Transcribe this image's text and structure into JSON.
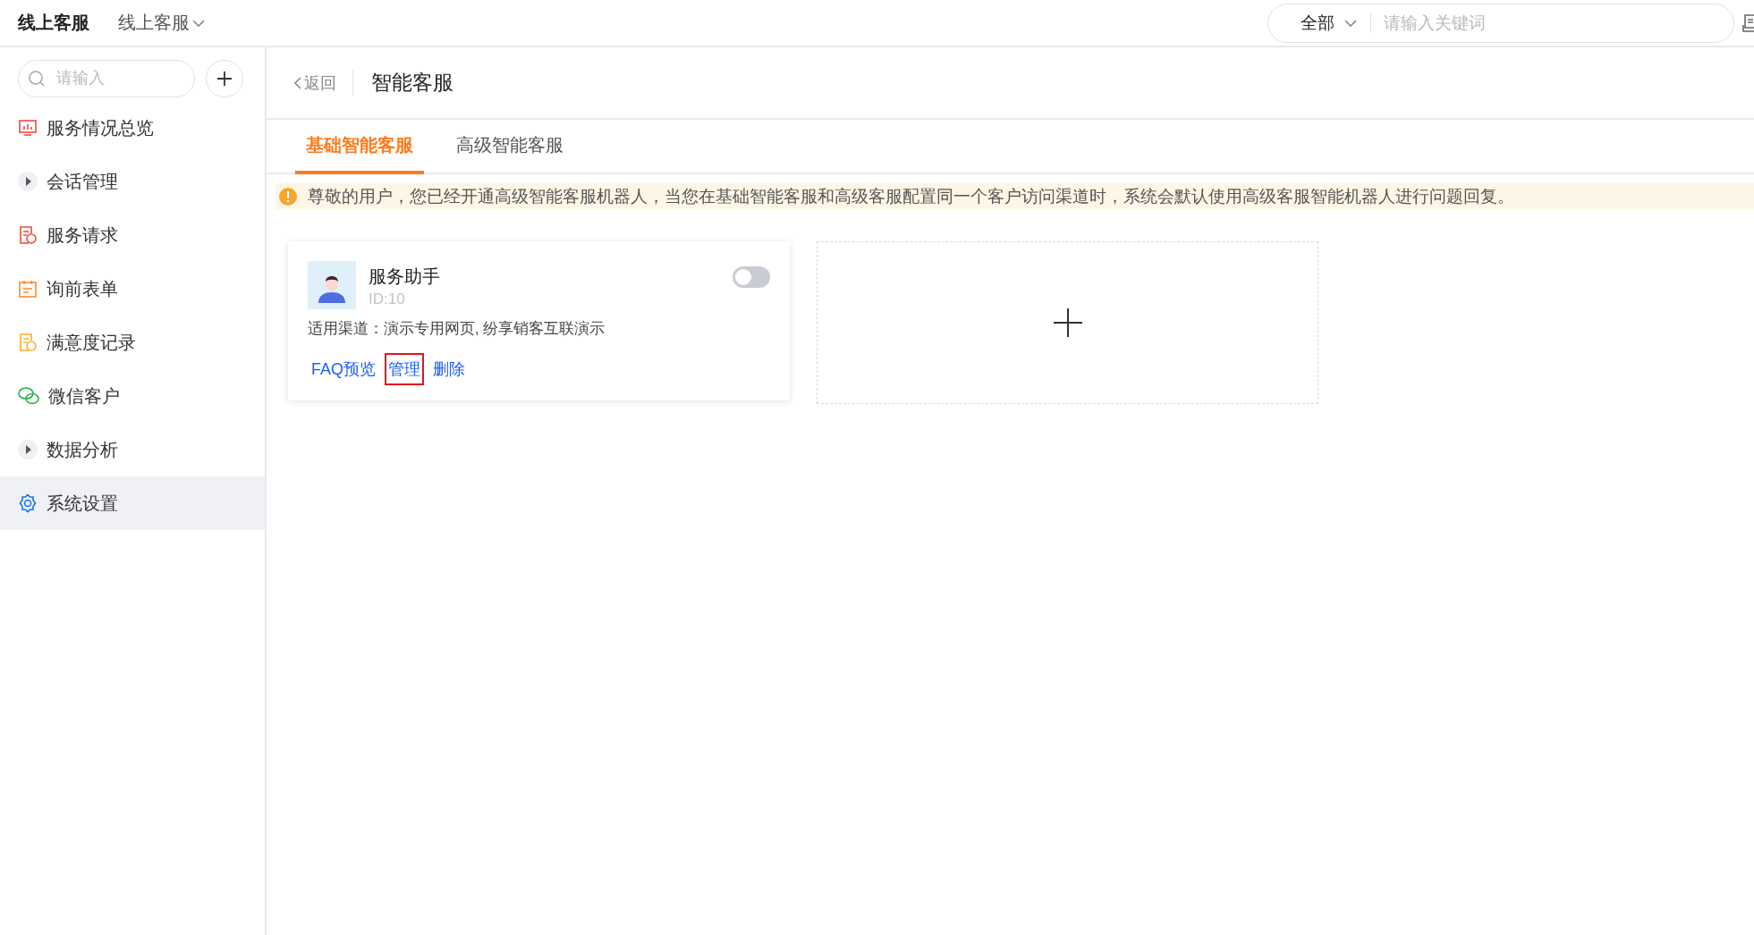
{
  "header": {
    "title": "线上客服",
    "switcher": "线上客服",
    "scope": "全部",
    "search": {
      "placeholder": "请输入关键词"
    }
  },
  "sidebar": {
    "search": {
      "placeholder": "请输入"
    },
    "items": [
      {
        "label": "服务情况总览",
        "kind": "monitor",
        "selected": false
      },
      {
        "label": "会话管理",
        "kind": "expand",
        "selected": false
      },
      {
        "label": "服务请求",
        "kind": "request",
        "selected": false
      },
      {
        "label": "询前表单",
        "kind": "form",
        "selected": false
      },
      {
        "label": "满意度记录",
        "kind": "rating",
        "selected": false
      },
      {
        "label": "微信客户",
        "kind": "wechat",
        "selected": false
      },
      {
        "label": "数据分析",
        "kind": "expand",
        "selected": false
      },
      {
        "label": "系统设置",
        "kind": "gear",
        "selected": true
      }
    ]
  },
  "page": {
    "back": "返回",
    "title": "智能客服",
    "tabs": [
      {
        "label": "基础智能客服",
        "selected": true
      },
      {
        "label": "高级智能客服",
        "selected": false
      }
    ],
    "notice": "尊敬的用户，您已经开通高级智能客服机器人，当您在基础智能客服和高级客服配置同一个客户访问渠道时，系统会默认使用高级客服智能机器人进行问题回复。",
    "bots": [
      {
        "name": "服务助手",
        "id": "ID:10",
        "on": false,
        "channels": "适用渠道：演示专用网页, 纷享销客互联演示",
        "actions": [
          {
            "label": "FAQ预览",
            "highlighted": false
          },
          {
            "label": "管理",
            "highlighted": true
          },
          {
            "label": "删除",
            "highlighted": false
          }
        ]
      }
    ]
  }
}
